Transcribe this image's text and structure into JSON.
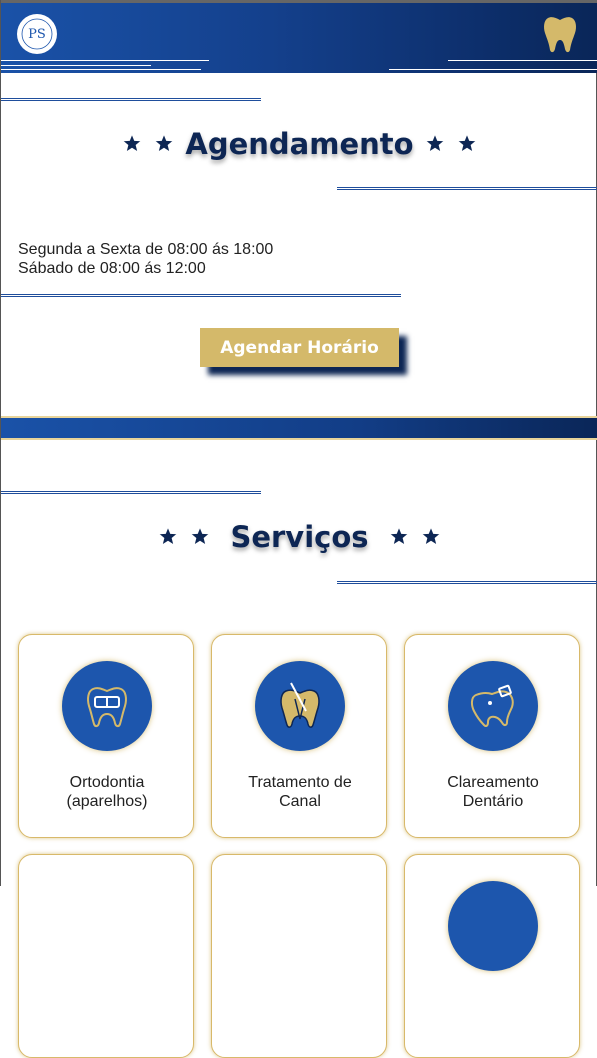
{
  "header": {
    "logo_text": "PS",
    "logo_icon": "ps-monogram-logo",
    "right_icon": "tooth-icon"
  },
  "colors": {
    "brand_blue": "#1a52a8",
    "navy": "#0d2654",
    "gold": "#d4b96a"
  },
  "schedule": {
    "title": "Agendamento",
    "hours_line1": "Segunda a Sexta de 08:00 ás 18:00",
    "hours_line2": "Sábado de 08:00 ás 12:00",
    "button_label": "Agendar Horário"
  },
  "services": {
    "title": "Serviços",
    "cards": [
      {
        "label_line1": "Ortodontia",
        "label_line2": "(aparelhos)",
        "icon": "braces-tooth-icon"
      },
      {
        "label_line1": "Tratamento de",
        "label_line2": "Canal",
        "icon": "root-canal-icon"
      },
      {
        "label_line1": "Clareamento",
        "label_line2": "Dentário",
        "icon": "whitening-tooth-icon"
      }
    ]
  }
}
